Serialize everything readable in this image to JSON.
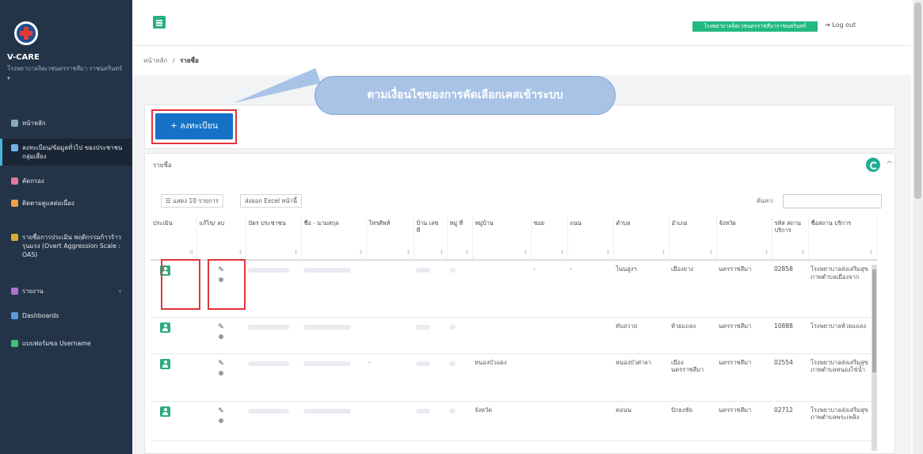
{
  "app": {
    "brand": "V-CARE",
    "brand_sub": "โรงพยาบาลจิตเวชนครราชสีมา ราชนครินทร์ ▾"
  },
  "sidebar": {
    "items": [
      {
        "label": "หน้าหลัก",
        "color": "#8aa6c0"
      },
      {
        "label": "ลงทะเบียน/ข้อมูลทั่วไป ของประชาชนกลุ่มเสี่ยง",
        "color": "#6fb4e8"
      },
      {
        "label": "คัดกรอง",
        "color": "#e07b9a"
      },
      {
        "label": "ติดตามดูแลต่อเนื่อง",
        "color": "#f0a040"
      },
      {
        "label": "รายชื่อการประเมิน พฤติกรรมก้าวร้าวรุนแรง (Overt Aggression Scale : OAS)",
        "color": "#d6b030"
      },
      {
        "label": "รายงาน",
        "color": "#b070d0"
      },
      {
        "label": "Dashboards",
        "color": "#5a9be0"
      },
      {
        "label": "แบบฟอร์มขอ Username",
        "color": "#3cc47a"
      }
    ],
    "chevron": "‹"
  },
  "topbar": {
    "hospital_btn": "โรงพยาบาลจิตเวชนครราชสีมาราชนครินทร์",
    "logout": "⇥ Log out"
  },
  "breadcrumb": {
    "home": "หน้าหลัก",
    "sep": "/",
    "current": "รายชื่อ"
  },
  "callout": "ตามเงื่อนไขของการคัดเลือกเคสเข้าระบบ",
  "register_btn": "+ ลงทะเบียน",
  "list_card": {
    "title": "รายชื่อ",
    "show_btn": "☰ แสดง 10 รายการ",
    "export_btn": "ส่งออก Excel หน้านี้",
    "search_label": "ค้นหา:"
  },
  "table": {
    "headers": [
      "ประเมิน",
      "แก้ไข/ ลบ",
      "บัตร ประชาชน",
      "ชื่อ - นามสกุล",
      "โทรศัพท์",
      "บ้าน เลข ที่",
      "หมู่ ที่",
      "หมู่บ้าน",
      "ซอย",
      "ถนน",
      "ตำบล",
      "อำเภอ",
      "จังหวัด",
      "รหัส สถาน บริการ",
      "ชื่อสถาน บริการ"
    ],
    "rows": [
      {
        "phone": "",
        "village": "",
        "soi": "-",
        "road": "-",
        "tambon": "โนนสูงฯ",
        "amphoe": "เมืองยาง",
        "province": "นครราชสีมา",
        "code": "02858",
        "service": "โรงพยาบาลส่งเสริมสุขภาพตำบลเมืองจาก"
      },
      {
        "phone": "",
        "village": "",
        "soi": "",
        "road": "",
        "tambon": "ทับสวาย",
        "amphoe": "ห้วยแถลง",
        "province": "นครราชสีมา",
        "code": "10888",
        "service": "โรงพยาบาลห้วยแถลง"
      },
      {
        "phone": "-",
        "village": "หนองบัวแดง",
        "soi": "",
        "road": "",
        "tambon": "หนองบัวศาลา",
        "amphoe": "เมืองนครราชสีมา",
        "province": "นครราชสีมา",
        "code": "02554",
        "service": "โรงพยาบาลส่งเสริมสุขภาพตำบลหนองไข่น้ำ"
      },
      {
        "phone": "",
        "village": "จังหวัด",
        "soi": "",
        "road": "",
        "tambon": "คอนน",
        "amphoe": "ปักธงชัย",
        "province": "นครราชสีมา",
        "code": "02712",
        "service": "โรงพยาบาลส่งเสริมสุขภาพตำบลพระเพลิง"
      }
    ]
  },
  "colors": {
    "accent": "#1572c6",
    "green": "#23b980",
    "highlight": "#e3353a"
  }
}
